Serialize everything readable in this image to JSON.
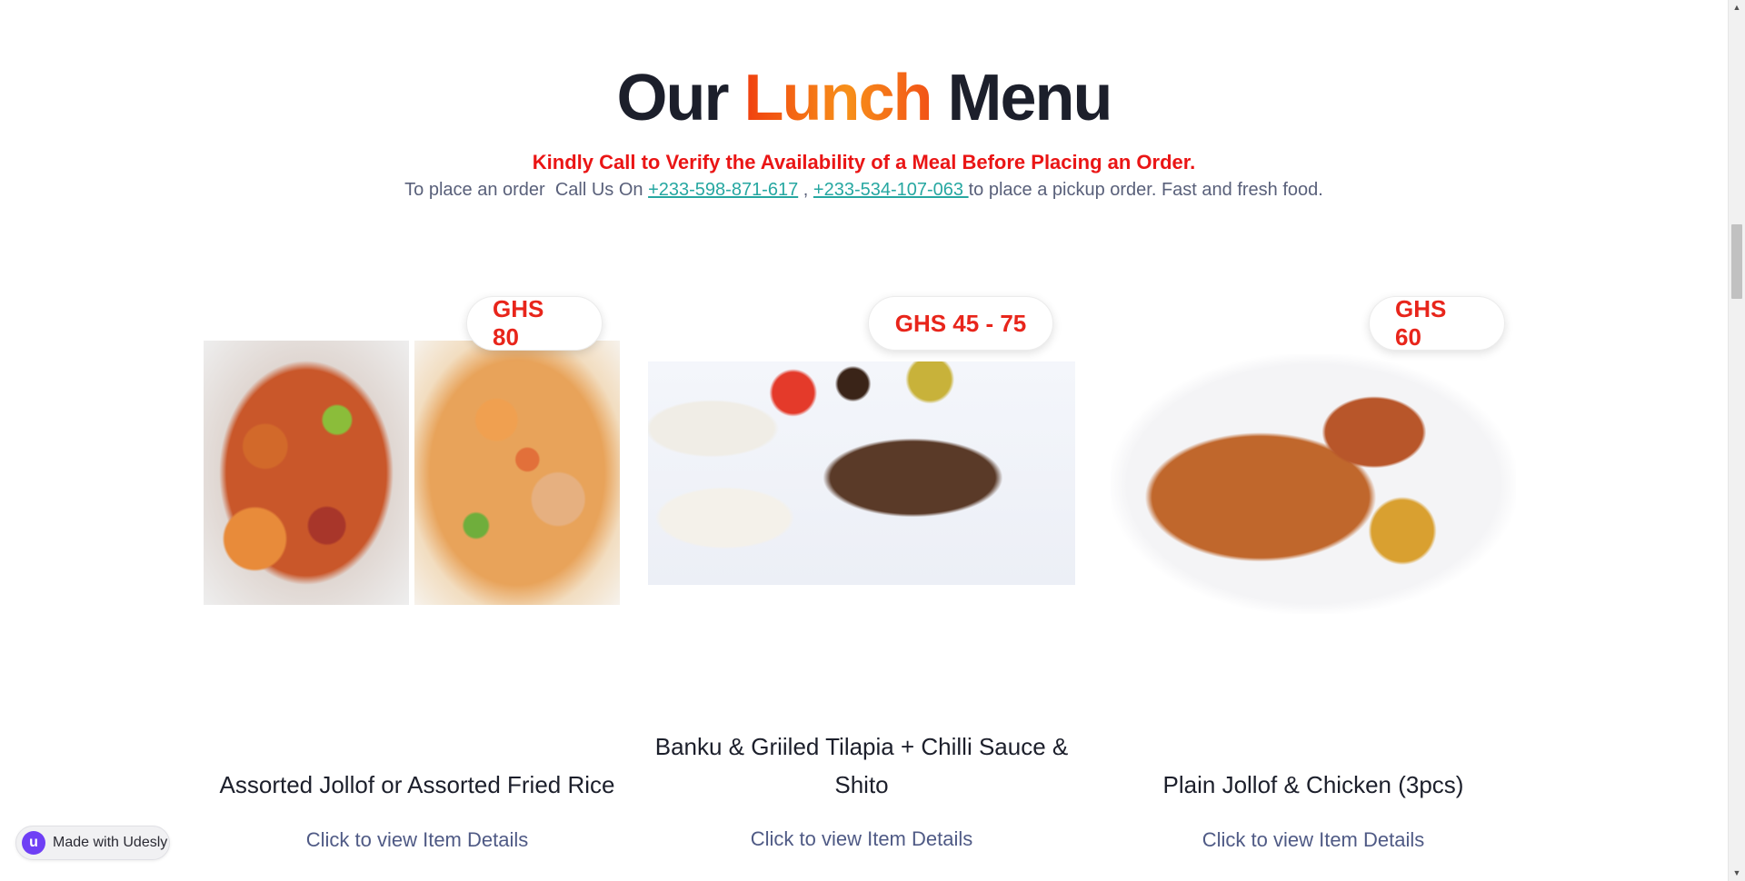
{
  "header": {
    "title_part1": "Our",
    "title_accent": "Lunch",
    "title_part2": "Menu",
    "notice": "Kindly Call to Verify the Availability of a Meal Before Placing an Order.",
    "call_prefix": "To place an order  Call Us On ",
    "phone_1": "+233-598-871-617",
    "separator": " , ",
    "phone_2": "+233-534-107-063 ",
    "call_suffix": "to place a pickup order. Fast and fresh food."
  },
  "menu": [
    {
      "price": "GHS 80",
      "name": "Assorted Jollof or Assorted Fried Rice",
      "details_link": "Click to view Item Details"
    },
    {
      "price": "GHS 45 - 75",
      "name": "Banku & Griiled Tilapia + Chilli Sauce & Shito",
      "details_link": "Click to view Item Details"
    },
    {
      "price": "GHS 60",
      "name": "Plain Jollof & Chicken (3pcs)",
      "details_link": "Click to view Item Details"
    }
  ],
  "badge": {
    "logo_letter": "u",
    "label": "Made with Udesly"
  },
  "colors": {
    "accent_red": "#ea1515",
    "link_teal": "#26a7a1",
    "heading": "#1c1f2b",
    "badge_purple": "#6f3ff5"
  },
  "icons": {
    "scroll_up": "scroll-up-arrow-icon",
    "scroll_down": "scroll-down-arrow-icon"
  }
}
